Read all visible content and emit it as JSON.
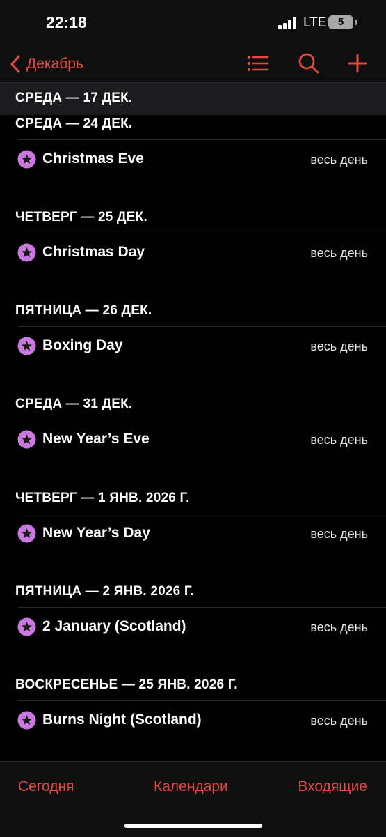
{
  "status_bar": {
    "time": "22:18",
    "network": "LTE",
    "battery": "5"
  },
  "nav": {
    "back_label": "Декабрь",
    "icons": [
      "list-icon",
      "search-icon",
      "plus-icon"
    ]
  },
  "sticky_header": "СРЕДА — 17 ДЕК.",
  "colors": {
    "accent": "#e5493c",
    "event_icon": "#c978e0",
    "background": "#000000"
  },
  "sections": [
    {
      "header": "СРЕДА — 24 ДЕК.",
      "event": {
        "title": "Christmas Eve",
        "time": "весь день"
      }
    },
    {
      "header": "ЧЕТВЕРГ — 25 ДЕК.",
      "event": {
        "title": "Christmas Day",
        "time": "весь день"
      }
    },
    {
      "header": "ПЯТНИЦА — 26 ДЕК.",
      "event": {
        "title": "Boxing Day",
        "time": "весь день"
      }
    },
    {
      "header": "СРЕДА — 31 ДЕК.",
      "event": {
        "title": "New Year’s Eve",
        "time": "весь день"
      }
    },
    {
      "header": "ЧЕТВЕРГ — 1 ЯНВ. 2026 Г.",
      "event": {
        "title": "New Year’s Day",
        "time": "весь день"
      }
    },
    {
      "header": "ПЯТНИЦА — 2 ЯНВ. 2026 Г.",
      "event": {
        "title": "2 January (Scotland)",
        "time": "весь день"
      }
    },
    {
      "header": "ВОСКРЕСЕНЬЕ — 25 ЯНВ. 2026 Г.",
      "event": {
        "title": "Burns Night (Scotland)",
        "time": "весь день"
      }
    }
  ],
  "tabs": {
    "today": "Сегодня",
    "calendars": "Календари",
    "inbox": "Входящие"
  }
}
